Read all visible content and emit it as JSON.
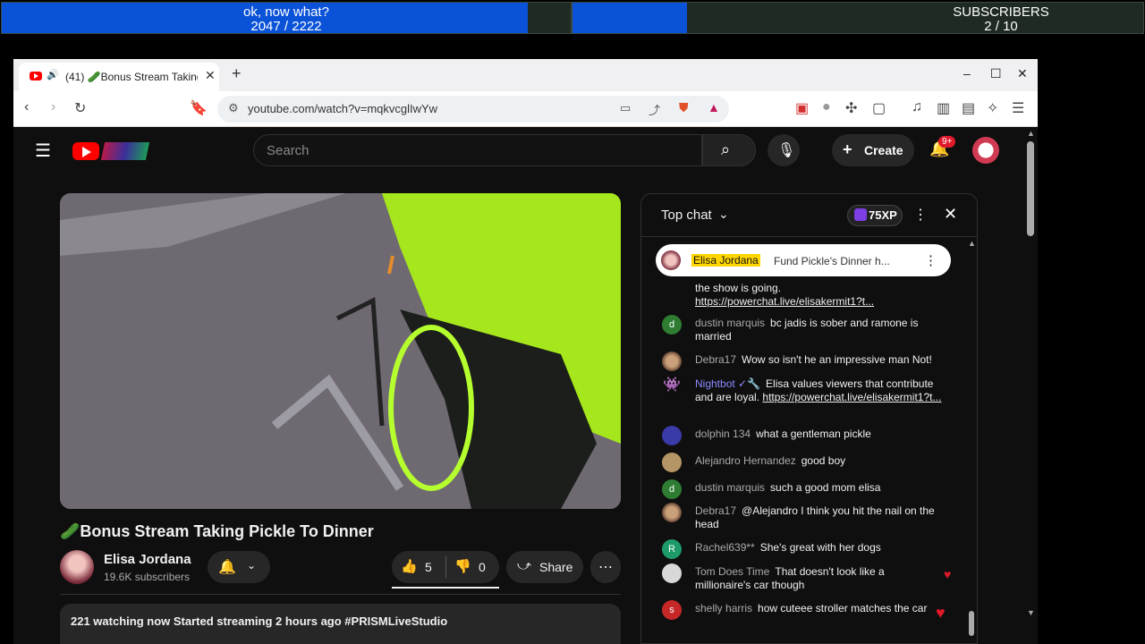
{
  "overlay": {
    "left": {
      "title": "ok, now what?",
      "current": 2047,
      "total": 2222,
      "progress_label": "2047  /  2222",
      "progress_fraction": 0.921
    },
    "right": {
      "title": "SUBSCRIBERS",
      "current": 2,
      "total": 10,
      "progress_label": "2  /  10",
      "progress_fraction": 0.2
    }
  },
  "browser": {
    "tab_title": "Bonus Stream Taking Pickle To Dinner",
    "tab_count_prefix": "(41)",
    "new_tab": "+",
    "url": "youtube.com/watch?v=mqkvcglIwYw",
    "window_min": "–",
    "window_max": "☐",
    "window_close": "✕"
  },
  "youtube": {
    "search_placeholder": "Search",
    "create_label": "Create",
    "notifications_badge": "9+",
    "video_title": "🥒Bonus Stream Taking Pickle To Dinner",
    "channel_name": "Elisa Jordana",
    "subscribers": "19.6K subscribers",
    "likes": "5",
    "dislikes": "0",
    "share_label": "Share",
    "description": "221 watching now  Started streaming 2 hours ago  #PRISMLiveStudio"
  },
  "chat": {
    "header_label": "Top chat",
    "xp_label": "75XP",
    "pinned_author": "Elisa Jordana",
    "pinned_text": "Fund Pickle's Dinner h...",
    "messages": [
      {
        "author": "",
        "text": "the show is going. ",
        "link": "https://powerchat.live/elisakermit1?t..."
      },
      {
        "author": "dustin marquis",
        "initial": "d",
        "text": "bc jadis is sober and ramone is married"
      },
      {
        "author": "Debra17",
        "text": "Wow so isn't he an impressive man Not!"
      },
      {
        "author": "Nightbot ✓🔧",
        "text": "Elisa values viewers that contribute and are loyal. ",
        "link": "https://powerchat.live/elisakermit1?t..."
      },
      {
        "author": "dolphin 134",
        "text": "what a gentleman pickle"
      },
      {
        "author": "Alejandro Hernandez",
        "text": "good boy"
      },
      {
        "author": "dustin marquis",
        "initial": "d",
        "text": "such a good mom elisa"
      },
      {
        "author": "Debra17",
        "text": "@Alejandro I think you hit the nail on the head"
      },
      {
        "author": "Rachel639**",
        "initial": "R",
        "text": "She's great with her dogs"
      },
      {
        "author": "Tom Does Time",
        "text": "That doesn't look like a millionaire's car though"
      },
      {
        "author": "shelly harris",
        "initial": "s",
        "text": "how cuteee stroller matches the car"
      }
    ]
  },
  "colors": {
    "progress_fill": "#0a52d8",
    "youtube_red": "#ff0000",
    "page_bg": "#0f0f0f"
  }
}
